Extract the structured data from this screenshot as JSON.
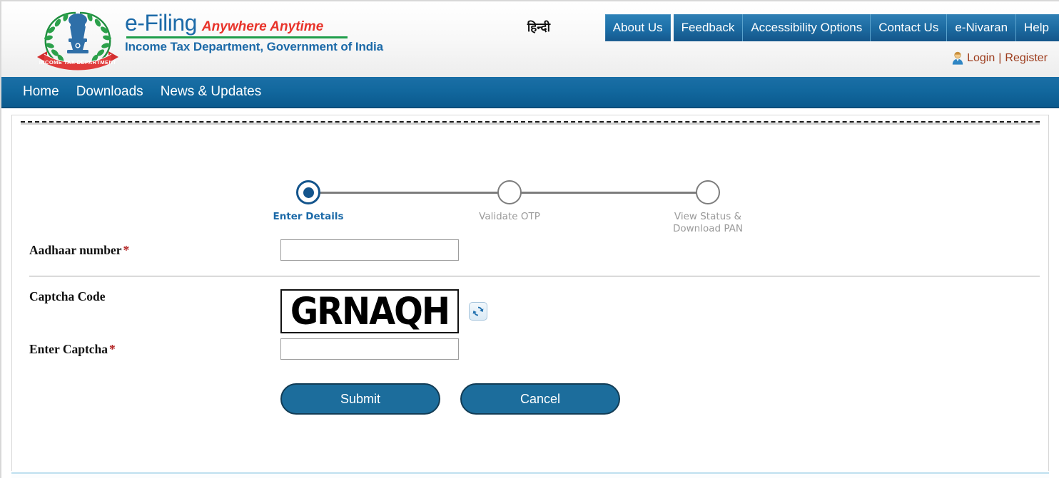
{
  "header": {
    "brand_name": "e-Filing",
    "brand_tagline": "Anywhere Anytime",
    "department_line": "Income Tax Department, Government of India",
    "logo_icon": "india-emblem-income-tax-logo",
    "hindi_link": "हिन्दी",
    "topnav": [
      {
        "label": "About Us",
        "active": true
      },
      {
        "label": "Feedback",
        "active": false
      },
      {
        "label": "Accessibility Options",
        "active": false
      },
      {
        "label": "Contact Us",
        "active": false
      },
      {
        "label": "e-Nivaran",
        "active": false
      },
      {
        "label": "Help",
        "active": false
      }
    ],
    "account": {
      "user_icon": "user-avatar-icon",
      "login_label": "Login",
      "separator": "|",
      "register_label": "Register"
    }
  },
  "mainnav": {
    "items": [
      {
        "label": "Home"
      },
      {
        "label": "Downloads"
      },
      {
        "label": "News & Updates"
      }
    ]
  },
  "stepper": {
    "steps": [
      {
        "label": "Enter Details",
        "active": true
      },
      {
        "label": "Validate OTP",
        "active": false
      },
      {
        "label": "View Status &\nDownload PAN",
        "active": false
      }
    ]
  },
  "form": {
    "aadhaar": {
      "label": "Aadhaar number",
      "required_mark": "*",
      "value": "",
      "placeholder": ""
    },
    "captcha_code": {
      "label": "Captcha Code",
      "code_text": "GRNAQH",
      "refresh_icon": "refresh-captcha-icon"
    },
    "enter_captcha": {
      "label": "Enter Captcha",
      "required_mark": "*",
      "value": "",
      "placeholder": ""
    },
    "buttons": {
      "submit_label": "Submit",
      "cancel_label": "Cancel"
    }
  },
  "colors": {
    "brand_blue": "#1c6aa8",
    "nav_blue": "#12689e",
    "accent_red": "#e8332a",
    "accent_green": "#1f9e4a",
    "required_red": "#b22222",
    "button_blue": "#1c6d9c",
    "login_link": "#9c3b1b",
    "step_inactive": "#9a9a9a"
  }
}
